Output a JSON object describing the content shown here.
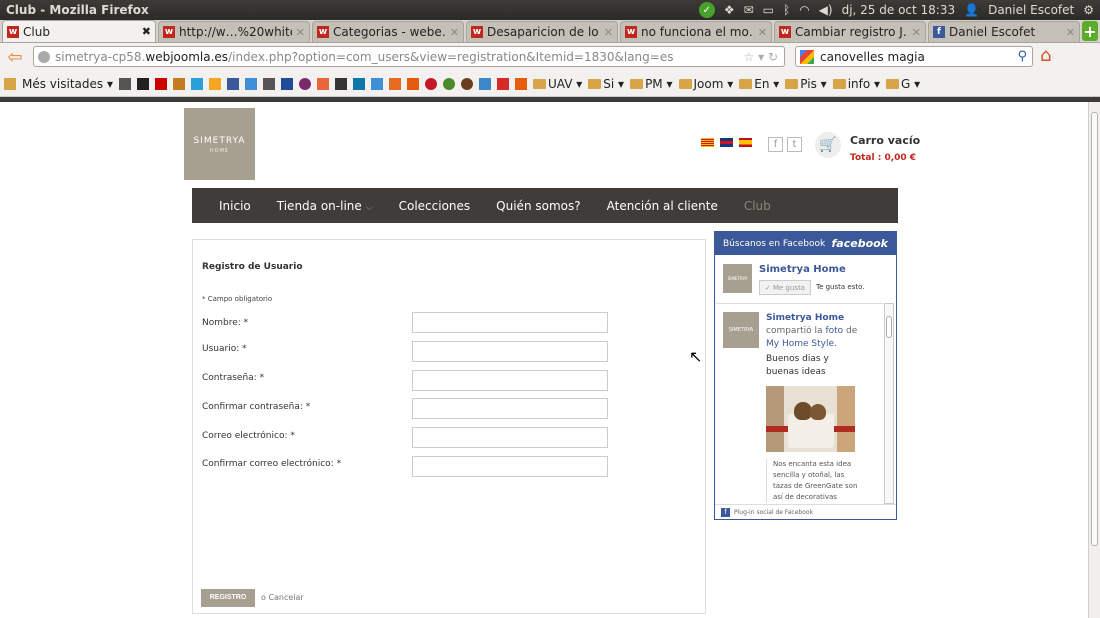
{
  "window": {
    "title": "Club - Mozilla Firefox",
    "clock": "dj, 25 de oct 18:33",
    "user": "Daniel Escofet"
  },
  "tabs": [
    {
      "label": "Club",
      "icon": "w",
      "active": true
    },
    {
      "label": "http://w…%20white",
      "icon": "w"
    },
    {
      "label": "Categorias - webe…",
      "icon": "w"
    },
    {
      "label": "Desaparicion de lo…",
      "icon": "w"
    },
    {
      "label": "no funciona el mo…",
      "icon": "w"
    },
    {
      "label": "Cambiar registro J…",
      "icon": "w"
    },
    {
      "label": "Daniel Escofet",
      "icon": "f"
    }
  ],
  "urlbar": {
    "prefix": "simetrya-cp58.",
    "domain": "webjoomla.es",
    "path": "/index.php?option=com_users&view=registration&Itemid=1830&lang=es"
  },
  "search": {
    "value": "canovelles magia"
  },
  "bookmarks": {
    "first": "Més visitades ▾",
    "folders": [
      "UAV ▾",
      "Si ▾",
      "PM ▾",
      "Joom ▾",
      "En ▾",
      "Pis ▾",
      "info ▾",
      "G ▾"
    ]
  },
  "site": {
    "logo": "SIMETRYA",
    "logo_sub": "HOME",
    "cart_title": "Carro vacío",
    "cart_total": "Total : 0,00 €",
    "menu": [
      "Inicio",
      "Tienda on-line",
      "Colecciones",
      "Quién somos?",
      "Atención al cliente",
      "Club"
    ]
  },
  "form": {
    "title": "Registro de Usuario",
    "required_note": "* Campo obligatorio",
    "fields": [
      "Nombre: *",
      "Usuario: *",
      "Contraseña: *",
      "Confirmar contraseña: *",
      "Correo electrónico: *",
      "Confirmar correo electrónico: *"
    ],
    "submit": "REGISTRO",
    "cancel": "o Cancelar"
  },
  "facebook": {
    "header": "Búscanos en Facebook",
    "brand": "facebook",
    "page_name": "Simetrya Home",
    "like_button": "Me gusta",
    "likes_text": "Te gusta esto.",
    "post_author": "Simetrya Home",
    "post_action_pre": "compartió la ",
    "post_action_link": "foto",
    "post_action_post": " de",
    "post_source": "My Home Style.",
    "post_line1": "Buenos dias y",
    "post_line2": "buenas ideas",
    "post_desc": "Nos encanta esta idea sencilla y otoñal, las tazas de GreenGate son así de decorativas",
    "footer": "Plug-in social de Facebook",
    "avatar_label": "SIMETRYA"
  }
}
